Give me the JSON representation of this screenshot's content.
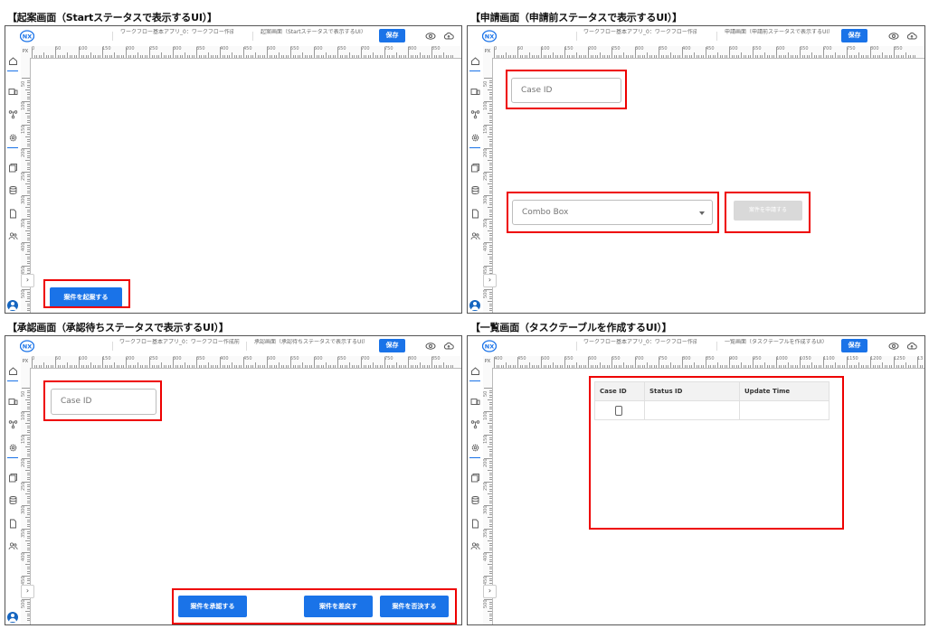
{
  "captions": {
    "p1": "【起案画面（Startステータスで表示するUI）】",
    "p2": "【申請画面（申請前ステータスで表示するUI）】",
    "p3": "【承認画面（承認待ちステータスで表示するUI）】",
    "p4": "【一覧画面（タスクテーブルを作成するUI）】"
  },
  "common": {
    "app_name": "ワークフロー基本アプリ_0：ワークフロー作成前",
    "save_label": "保存",
    "px_label": "PX",
    "expander_glyph": "›",
    "ruler_ticks": [
      "0",
      "50",
      "100",
      "150",
      "200",
      "250",
      "300",
      "350",
      "400",
      "450",
      "500",
      "550",
      "600",
      "650",
      "700",
      "750",
      "800",
      "850"
    ],
    "ruler_ticks_list": [
      "400",
      "450",
      "500",
      "550",
      "600",
      "650",
      "700",
      "750",
      "800",
      "850",
      "900",
      "950",
      "1000",
      "1050",
      "1100",
      "1150",
      "1200",
      "1250",
      "13"
    ],
    "vruler_ticks": [
      "50",
      "100",
      "150",
      "200",
      "250",
      "300",
      "350",
      "400",
      "450",
      "500"
    ],
    "accent": "#1a73e8",
    "highlight": "#ee0000"
  },
  "p1": {
    "screen_name": "起案画面（Startステータスで表示するUI）",
    "start_button": "案件を起案する"
  },
  "p2": {
    "screen_name": "申請画面（申請前ステータスで表示するUI）",
    "case_id_placeholder": "Case ID",
    "combo_placeholder": "Combo Box",
    "apply_button": "案件を申請する"
  },
  "p3": {
    "app_name": "ワークフロー基本アプリ_0：ワークフロー作成前",
    "screen_name": "承認画面（承認待ちステータスで表示するUI）",
    "case_id_placeholder": "Case ID",
    "approve_button": "案件を承認する",
    "return_button": "案件を差戻す",
    "reject_button": "案件を否決する"
  },
  "p4": {
    "screen_name": "一覧画面（タスクテーブルを作成するUI）",
    "table": {
      "headers": [
        "Case ID",
        "Status ID",
        "Update Time"
      ]
    }
  }
}
